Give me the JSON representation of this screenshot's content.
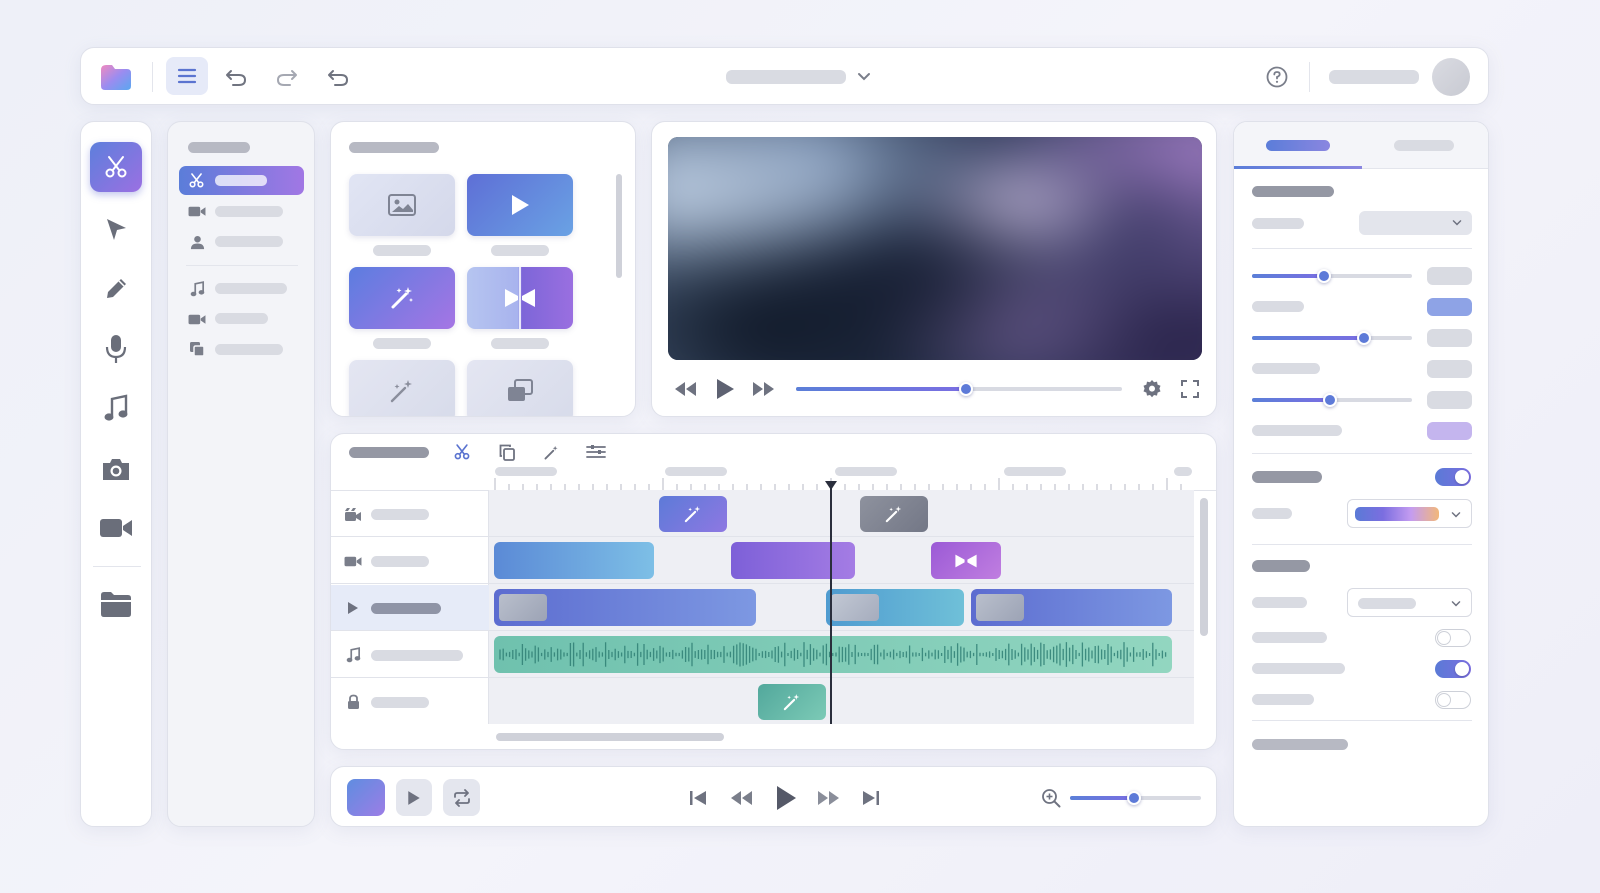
{
  "app": {
    "logo_icon": "folder-gradient-logo",
    "accent": "#6a7bdc",
    "accent2": "#9a6ee0",
    "teal": "#5fb9a6"
  },
  "toolbar": {
    "icons": [
      "menu-icon",
      "undo-icon",
      "redo-icon",
      "back-icon"
    ],
    "right_icons": [
      "help-icon"
    ],
    "avatar": "avatar"
  },
  "left_rail": {
    "tools": [
      "scissors-icon",
      "cursor-icon",
      "pencil-icon",
      "microphone-icon",
      "music-note-icon",
      "camera-icon",
      "video-camera-icon",
      "folder-icon"
    ],
    "active": "scissors-icon"
  },
  "nav_panel": {
    "items": [
      "scissors-icon",
      "video-camera-icon",
      "person-icon",
      "music-note-icon",
      "video-camera-icon",
      "copy-icon"
    ],
    "active_index": 0
  },
  "media_panel": {
    "thumbnails": [
      "image-icon",
      "play-icon",
      "magic-wand-icon",
      "transition-icon",
      "sparkle-icon",
      "layers-icon"
    ]
  },
  "preview": {
    "progress": 0.52,
    "controls": [
      "rewind-icon",
      "play-icon",
      "fast-forward-icon",
      "settings-icon",
      "fullscreen-icon"
    ]
  },
  "timeline": {
    "tool_icons": [
      "scissors-icon",
      "copy-icon",
      "magic-wand-icon",
      "adjust-icon"
    ],
    "track_icons": [
      "clapper-icon",
      "video-camera-icon",
      "play-icon",
      "music-note-icon",
      "lock-icon"
    ],
    "selected_track": 2,
    "playhead": 0.485
  },
  "transport": {
    "controls": [
      "skip-back-icon",
      "rewind-icon",
      "play-icon",
      "fast-forward-icon",
      "skip-forward-icon"
    ],
    "zoom_icon": "zoom-in-icon",
    "zoom_level": 0.49
  },
  "properties": {
    "active_tab": 0,
    "sliders": [
      0.45,
      0.7,
      0.49
    ],
    "toggles": [
      true,
      false,
      true,
      false
    ],
    "swatch_colors": [
      "#5a7ad6",
      "#7b6ee0",
      "#c49cf0",
      "#f2b77a"
    ],
    "value_colors": [
      "#8ea3e6",
      "#c4b5ee"
    ]
  }
}
